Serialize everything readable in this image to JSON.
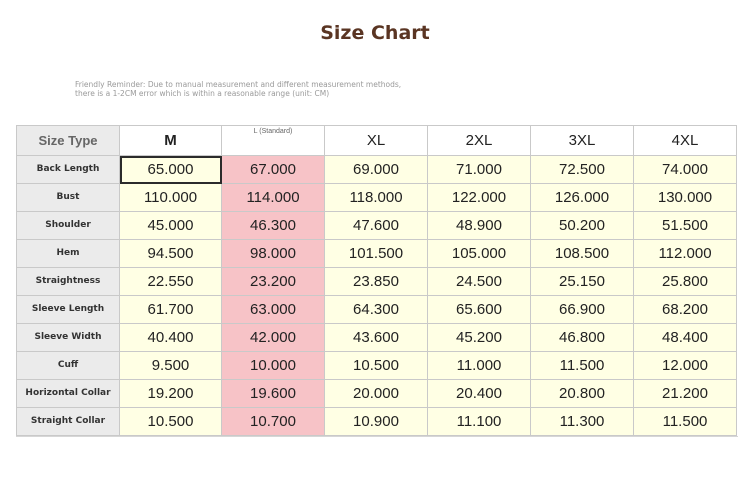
{
  "title": "Size Chart",
  "reminder": {
    "line1": "Friendly Reminder: Due to manual measurement and different measurement methods,",
    "line2": "there is a 1-2CM error which is within a reasonable range (unit: CM)"
  },
  "table": {
    "corner": "Size Type",
    "columns": [
      "M",
      "L (Standard)",
      "XL",
      "2XL",
      "3XL",
      "4XL"
    ],
    "rows": [
      {
        "label": "Back Length",
        "values": [
          "65.000",
          "67.000",
          "69.000",
          "71.000",
          "72.500",
          "74.000"
        ]
      },
      {
        "label": "Bust",
        "values": [
          "110.000",
          "114.000",
          "118.000",
          "122.000",
          "126.000",
          "130.000"
        ]
      },
      {
        "label": "Shoulder",
        "values": [
          "45.000",
          "46.300",
          "47.600",
          "48.900",
          "50.200",
          "51.500"
        ]
      },
      {
        "label": "Hem",
        "values": [
          "94.500",
          "98.000",
          "101.500",
          "105.000",
          "108.500",
          "112.000"
        ]
      },
      {
        "label": "Straightness",
        "values": [
          "22.550",
          "23.200",
          "23.850",
          "24.500",
          "25.150",
          "25.800"
        ]
      },
      {
        "label": "Sleeve Length",
        "values": [
          "61.700",
          "63.000",
          "64.300",
          "65.600",
          "66.900",
          "68.200"
        ]
      },
      {
        "label": "Sleeve Width",
        "values": [
          "40.400",
          "42.000",
          "43.600",
          "45.200",
          "46.800",
          "48.400"
        ]
      },
      {
        "label": "Cuff",
        "values": [
          "9.500",
          "10.000",
          "10.500",
          "11.000",
          "11.500",
          "12.000"
        ]
      },
      {
        "label": "Horizontal Collar",
        "values": [
          "19.200",
          "19.600",
          "20.000",
          "20.400",
          "20.800",
          "21.200"
        ]
      },
      {
        "label": "Straight Collar",
        "values": [
          "10.500",
          "10.700",
          "10.900",
          "11.100",
          "11.300",
          "11.500"
        ]
      }
    ]
  },
  "colors": {
    "title": "#5a3523",
    "cell_bg": "#ffffe4",
    "highlight_column": "#f7c3c7",
    "label_bg": "#ebebeb"
  }
}
